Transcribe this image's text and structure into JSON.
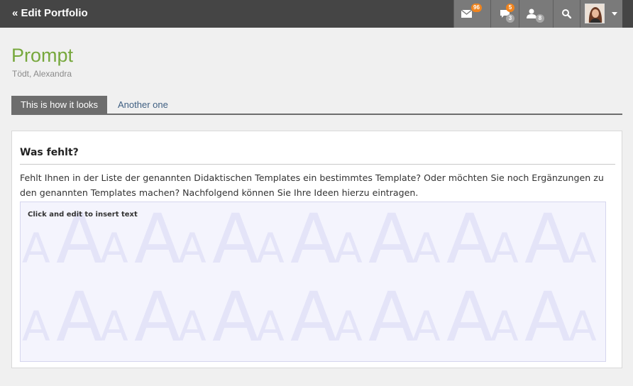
{
  "header": {
    "back_label": "« Edit Portfolio",
    "mail_count": "96",
    "messages_count": "5",
    "messages_sub_count": "3",
    "users_count": "8"
  },
  "page": {
    "title": "Prompt",
    "author": "Tödt, Alexandra"
  },
  "tabs": [
    {
      "label": "This is how it looks",
      "active": true
    },
    {
      "label": "Another one",
      "active": false
    }
  ],
  "block": {
    "title": "Was fehlt?",
    "text": "Fehlt Ihnen in der Liste der genannten Didaktischen Templates ein bestimmtes Template? Oder möchten Sie noch Ergänzungen zu den genannten Templates machen? Nachfolgend können Sie Ihre Ideen hierzu eintragen.",
    "editor_hint": "Click and edit to insert text"
  },
  "colors": {
    "topbar": "#454545",
    "accent_green": "#77a83d",
    "badge_orange": "#f0841e",
    "tab_active": "#6d6d6d",
    "link_blue": "#3f5f82"
  },
  "icons": [
    "envelope-icon",
    "chat-bubble-icon",
    "user-icon",
    "search-icon",
    "chevron-down-icon"
  ]
}
